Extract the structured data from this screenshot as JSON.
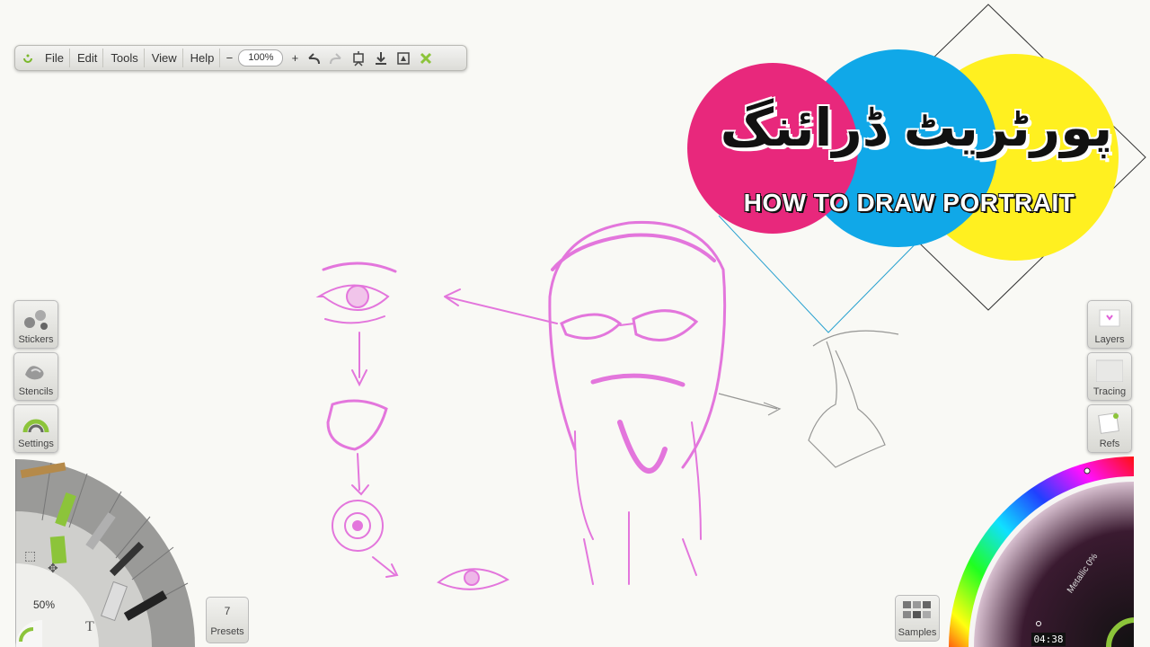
{
  "toolbar": {
    "menu": [
      "File",
      "Edit",
      "Tools",
      "View",
      "Help"
    ],
    "zoom": "100%",
    "zoom_minus": "−",
    "zoom_plus": "+"
  },
  "title": {
    "urdu": "پورٹریٹ ڈرائنگ",
    "english": "HOW TO DRAW PORTRAIT"
  },
  "left_panel": {
    "stickers": "Stickers",
    "stencils": "Stencils",
    "settings": "Settings"
  },
  "right_panel": {
    "layers": "Layers",
    "tracing": "Tracing",
    "refs": "Refs"
  },
  "tool_wheel": {
    "size": "50%"
  },
  "presets": {
    "count": "7",
    "label": "Presets"
  },
  "samples": {
    "label": "Samples"
  },
  "color_picker": {
    "metallic": "Metallic 0%"
  },
  "timer": "04:38",
  "colors": {
    "sketch": "#e060d8",
    "magenta": "#e8287c",
    "cyan": "#10a8e8",
    "yellow": "#fff020",
    "accent": "#9ccc3c"
  }
}
